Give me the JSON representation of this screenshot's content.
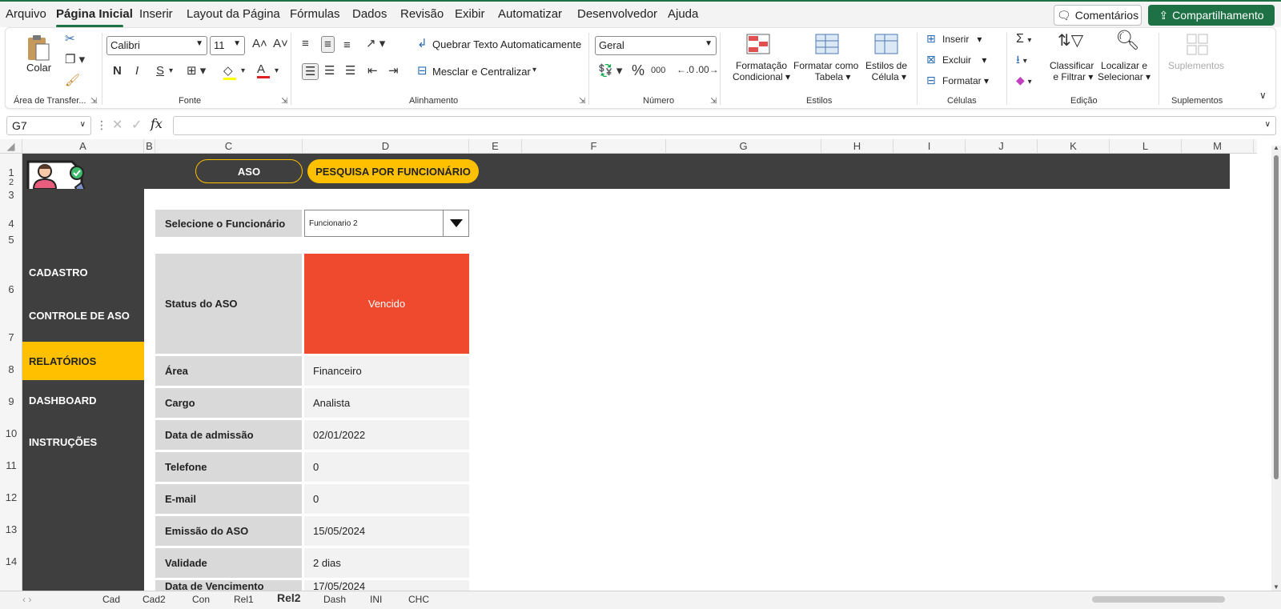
{
  "menu": {
    "items": [
      "Arquivo",
      "Página Inicial",
      "Inserir",
      "Layout da Página",
      "Fórmulas",
      "Dados",
      "Revisão",
      "Exibir",
      "Automatizar",
      "Desenvolvedor",
      "Ajuda"
    ],
    "comments_label": "Comentários",
    "share_label": "Compartilhamento"
  },
  "ribbon": {
    "clipboard": {
      "paste_label": "Colar",
      "group_label": "Área de Transfer..."
    },
    "font": {
      "font_name": "Calibri",
      "font_size": "11",
      "bold": "N",
      "italic": "I",
      "underline": "S",
      "group_label": "Fonte"
    },
    "alignment": {
      "wrap_label": "Quebrar Texto Automaticamente",
      "merge_label": "Mesclar e Centralizar",
      "group_label": "Alinhamento"
    },
    "number": {
      "format": "Geral",
      "group_label": "Número"
    },
    "styles": {
      "conditional_line1": "Formatação",
      "conditional_line2": "Condicional",
      "table_line1": "Formatar como",
      "table_line2": "Tabela",
      "cell_line1": "Estilos de",
      "cell_line2": "Célula",
      "group_label": "Estilos"
    },
    "cells": {
      "insert_label": "Inserir",
      "delete_label": "Excluir",
      "format_label": "Formatar",
      "group_label": "Células"
    },
    "editing": {
      "sort_line1": "Classificar",
      "sort_line2": "e Filtrar",
      "find_line1": "Localizar e",
      "find_line2": "Selecionar",
      "group_label": "Edição"
    },
    "addins": {
      "label": "Suplementos",
      "group_label": "Suplementos"
    }
  },
  "formula_bar": {
    "name_box": "G7",
    "fx": "fx"
  },
  "columns": [
    "A",
    "B",
    "C",
    "D",
    "E",
    "F",
    "G",
    "H",
    "I",
    "J",
    "K",
    "L",
    "M"
  ],
  "rows": [
    "1",
    "2",
    "3",
    "4",
    "5",
    "6",
    "7",
    "8",
    "9",
    "10",
    "11",
    "12",
    "13",
    "14"
  ],
  "sheet": {
    "top_buttons": {
      "aso": "ASO",
      "search": "PESQUISA POR FUNCIONÁRIO"
    },
    "nav": [
      "CADASTRO",
      "CONTROLE DE ASO",
      "RELATÓRIOS",
      "DASHBOARD",
      "INSTRUÇÕES"
    ],
    "select_label": "Selecione o Funcionário",
    "select_value": "Funcionario 2",
    "status_label": "Status do ASO",
    "status_value": "Vencido",
    "fields": [
      {
        "label": "Área",
        "value": "Financeiro"
      },
      {
        "label": "Cargo",
        "value": "Analista"
      },
      {
        "label": "Data de admissão",
        "value": "02/01/2022"
      },
      {
        "label": "Telefone",
        "value": "0"
      },
      {
        "label": "E-mail",
        "value": "0"
      },
      {
        "label": "Emissão do ASO",
        "value": "15/05/2024"
      },
      {
        "label": "Validade",
        "value": "2 dias"
      },
      {
        "label": "Data de Vencimento",
        "value": "17/05/2024"
      }
    ]
  },
  "sheet_tabs": [
    "Cad",
    "Cad2",
    "Con",
    "Rel1",
    "Rel2",
    "Dash",
    "INI",
    "CHC"
  ],
  "colors": {
    "accent": "#1e7145",
    "nav_bg": "#3f3f3f",
    "highlight": "#ffc000",
    "status_expired": "#f04a2e"
  },
  "icons": [
    "paste-icon",
    "cut-icon",
    "copy-icon",
    "format-painter-icon",
    "autosum-icon",
    "sort-filter-icon",
    "find-icon",
    "addins-icon",
    "dropdown-arrow-icon",
    "employee-badge-icon"
  ]
}
